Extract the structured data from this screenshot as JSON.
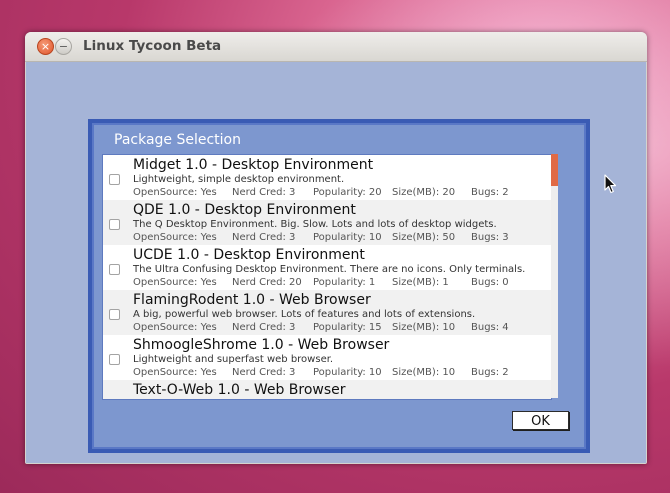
{
  "window": {
    "title": "Linux Tycoon Beta",
    "close_glyph": "×",
    "minimize_glyph": "−"
  },
  "dialog": {
    "title": "Package Selection",
    "ok_label": "OK"
  },
  "stat_labels": {
    "opensource": "OpenSource:",
    "nerdcred": "Nerd Cred:",
    "popularity": "Popularity:",
    "size": "Size(MB):",
    "bugs": "Bugs:"
  },
  "packages": [
    {
      "name": "Midget 1.0 - Desktop Environment",
      "description": "Lightweight, simple desktop environment.",
      "opensource": "OpenSource: Yes",
      "nerdcred": "Nerd Cred: 3",
      "popularity": "Popularity: 20",
      "size": "Size(MB): 20",
      "bugs": "Bugs: 2",
      "checked": false
    },
    {
      "name": "QDE 1.0 - Desktop Environment",
      "description": "The Q Desktop Environment.  Big.  Slow.  Lots and lots of desktop widgets.",
      "opensource": "OpenSource: Yes",
      "nerdcred": "Nerd Cred: 3",
      "popularity": "Popularity: 10",
      "size": "Size(MB): 50",
      "bugs": "Bugs: 3",
      "checked": false
    },
    {
      "name": "UCDE 1.0 - Desktop Environment",
      "description": "The Ultra Confusing Desktop Environment.  There are no icons.  Only terminals.",
      "opensource": "OpenSource: Yes",
      "nerdcred": "Nerd Cred: 20",
      "popularity": "Popularity: 1",
      "size": "Size(MB): 1",
      "bugs": "Bugs: 0",
      "checked": false
    },
    {
      "name": "FlamingRodent 1.0 - Web Browser",
      "description": "A big, powerful web browser.  Lots of features and lots of extensions.",
      "opensource": "OpenSource: Yes",
      "nerdcred": "Nerd Cred: 3",
      "popularity": "Popularity: 15",
      "size": "Size(MB): 10",
      "bugs": "Bugs: 4",
      "checked": false
    },
    {
      "name": "ShmoogleShrome 1.0 - Web Browser",
      "description": "Lightweight and superfast web browser.",
      "opensource": "OpenSource: Yes",
      "nerdcred": "Nerd Cred: 3",
      "popularity": "Popularity: 10",
      "size": "Size(MB): 10",
      "bugs": "Bugs: 2",
      "checked": false
    },
    {
      "name": "Text-O-Web 1.0 - Web Browser",
      "description": "",
      "opensource": "",
      "nerdcred": "",
      "popularity": "",
      "size": "",
      "bugs": "",
      "checked": false
    }
  ],
  "icons": {
    "cursor": "mouse-pointer-icon"
  },
  "colors": {
    "dialog_bg": "#7d97cf",
    "dialog_border": "#3a5bb4",
    "content_bg": "#a5b4d7",
    "scroll_thumb": "#e06a45",
    "close_button": "#e0542a"
  }
}
